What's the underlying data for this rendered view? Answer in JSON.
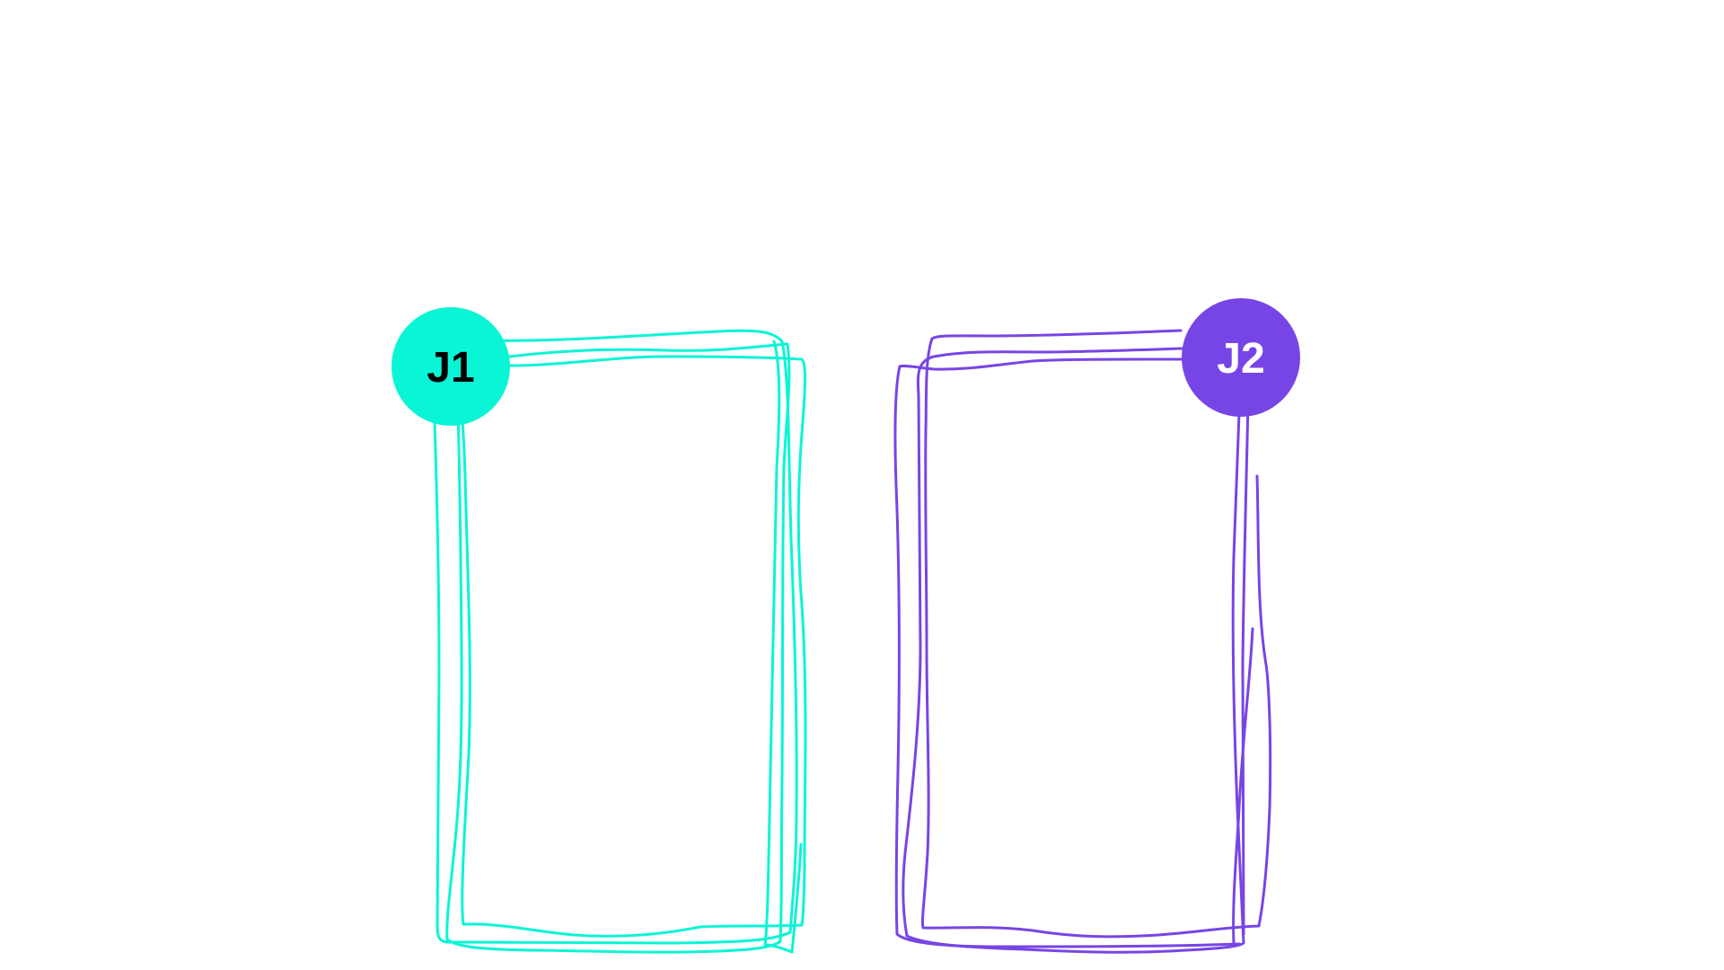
{
  "players": [
    {
      "label": "J1",
      "color": "#0af5d5",
      "label_color": "#000000"
    },
    {
      "label": "J2",
      "color": "#7745e6",
      "label_color": "#ffffff"
    }
  ]
}
